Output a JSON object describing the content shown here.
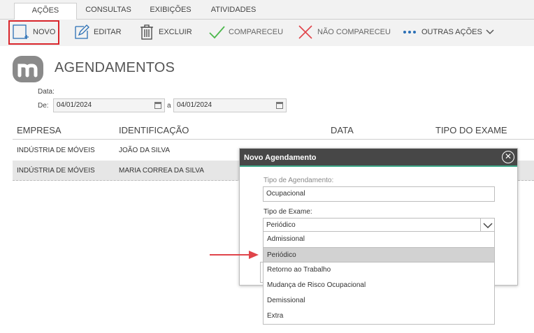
{
  "tabs": [
    {
      "label": "AÇÕES",
      "active": true
    },
    {
      "label": "CONSULTAS",
      "active": false
    },
    {
      "label": "EXIBIÇÕES",
      "active": false
    },
    {
      "label": "ATIVIDADES",
      "active": false
    }
  ],
  "toolbar": {
    "novo": "NOVO",
    "editar": "EDITAR",
    "excluir": "EXCLUIR",
    "compareceu": "COMPARECEU",
    "nao_compareceu": "NÃO COMPARECEU",
    "outras_acoes": "OUTRAS AÇÕES"
  },
  "page": {
    "title": "AGENDAMENTOS",
    "date_label": "Data:",
    "from_label": "De:",
    "to_label": "a",
    "date_from": "04/01/2024",
    "date_to": "04/01/2024"
  },
  "grid": {
    "columns": [
      "EMPRESA",
      "IDENTIFICAÇÃO",
      "DATA",
      "TIPO DO EXAME"
    ],
    "rows": [
      {
        "empresa": "INDÚSTRIA DE MÓVEIS",
        "identificacao": "JOÃO DA SILVA"
      },
      {
        "empresa": "INDÚSTRIA DE MÓVEIS",
        "identificacao": "MARIA CORREA DA SILVA"
      }
    ]
  },
  "modal": {
    "title": "Novo Agendamento",
    "tipo_agendamento_label": "Tipo de Agendamento:",
    "tipo_agendamento_value": "Ocupacional",
    "tipo_exame_label": "Tipo de Exame:",
    "tipo_exame_value": "Periódico",
    "options": [
      "Admissional",
      "Periódico",
      "Retorno ao Trabalho",
      "Mudança de Risco Ocupacional",
      "Demissional",
      "Extra"
    ],
    "selected_index": 1
  },
  "colors": {
    "accent_green": "#3fa98a",
    "highlight_red": "#d9262c",
    "modal_header": "#474747",
    "check_green": "#4cb84c",
    "cross_red": "#e0444a",
    "toolbar_blue": "#2a6fb5"
  },
  "icons": [
    "new-document-icon",
    "edit-icon",
    "trash-icon",
    "check-icon",
    "cross-icon",
    "more-dots-icon",
    "chevron-down-icon",
    "calendar-icon",
    "close-icon",
    "brand-logo"
  ]
}
